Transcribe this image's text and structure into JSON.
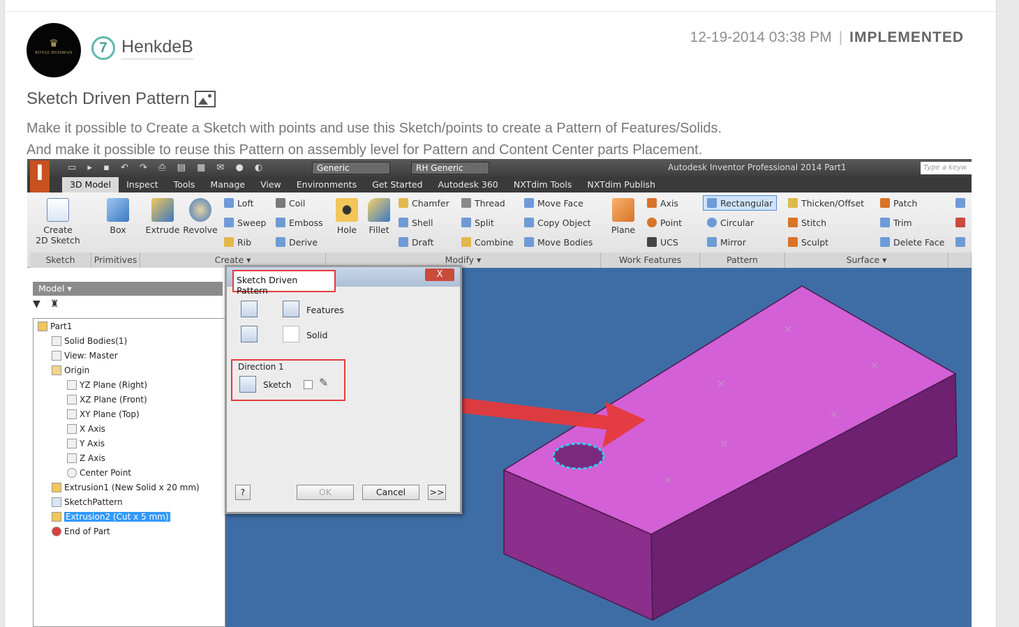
{
  "post": {
    "avatar_text": "ROYAL HUISMAN",
    "rank": "7",
    "author": "HenkdeB",
    "date": "12-19-2014 03:38 PM",
    "separator": "|",
    "status": "IMPLEMENTED",
    "title": "Sketch Driven Pattern",
    "desc_line1": "Make it possible to Create a Sketch with points and use this Sketch/points to create a Pattern of Features/Solids.",
    "desc_line2": "And make it possible to reuse this Pattern on assembly level for Pattern and Content Center parts Placement."
  },
  "inventor": {
    "qat": {
      "material": "Generic",
      "appearance": "RH Generic",
      "window_title": "Autodesk Inventor Professional 2014   Part1",
      "search_placeholder": "Type a keyw"
    },
    "tabs": [
      "3D Model",
      "Inspect",
      "Tools",
      "Manage",
      "View",
      "Environments",
      "Get Started",
      "Autodesk 360",
      "NXTdim Tools",
      "NXTdim Publish"
    ],
    "ribbon": {
      "sketch": {
        "create": "Create",
        "create2": "2D Sketch"
      },
      "primitives": {
        "box": "Box"
      },
      "create": {
        "extrude": "Extrude",
        "revolve": "Revolve",
        "loft": "Loft",
        "sweep": "Sweep",
        "rib": "Rib",
        "coil": "Coil",
        "emboss": "Emboss",
        "derive": "Derive"
      },
      "modify": {
        "hole": "Hole",
        "fillet": "Fillet",
        "chamfer": "Chamfer",
        "shell": "Shell",
        "draft": "Draft",
        "thread": "Thread",
        "split": "Split",
        "combine": "Combine",
        "move_face": "Move Face",
        "copy_object": "Copy Object",
        "move_bodies": "Move Bodies"
      },
      "work": {
        "plane": "Plane",
        "axis": "Axis",
        "point": "Point",
        "ucs": "UCS"
      },
      "pattern": {
        "rectangular": "Rectangular",
        "circular": "Circular",
        "mirror": "Mirror"
      },
      "surface": {
        "thicken": "Thicken/Offset",
        "stitch": "Stitch",
        "sculpt": "Sculpt",
        "patch": "Patch",
        "trim": "Trim",
        "delete_face": "Delete Face"
      },
      "groups": {
        "sketch": "Sketch",
        "primitives": "Primitives",
        "create": "Create ▾",
        "modify": "Modify ▾",
        "work": "Work Features",
        "pattern": "Pattern",
        "surface": "Surface ▾"
      }
    },
    "browser": {
      "header": "Model ▾",
      "tree": [
        "Part1",
        "Solid Bodies(1)",
        "View: Master",
        "Origin",
        "YZ Plane (Right)",
        "XZ Plane (Front)",
        "XY Plane (Top)",
        "X Axis",
        "Y Axis",
        "Z Axis",
        "Center Point",
        "Extrusion1 (New Solid x 20 mm)",
        "SketchPattern",
        "Extrusion2 (Cut x 5 mm)",
        "End of Part"
      ]
    },
    "dialog": {
      "title": "Sketch Driven Pattern",
      "close": "X",
      "features": "Features",
      "solid": "Solid",
      "direction": "Direction 1",
      "sketch": "Sketch",
      "ok": "OK",
      "cancel": "Cancel",
      "more": ">>",
      "help": "?"
    }
  },
  "colors": {
    "part_top": "#d360d6",
    "part_front": "#8c2e8c",
    "part_side": "#6d2170",
    "viewport_bg": "#3e6da5",
    "highlight_red": "#e53a3a"
  }
}
